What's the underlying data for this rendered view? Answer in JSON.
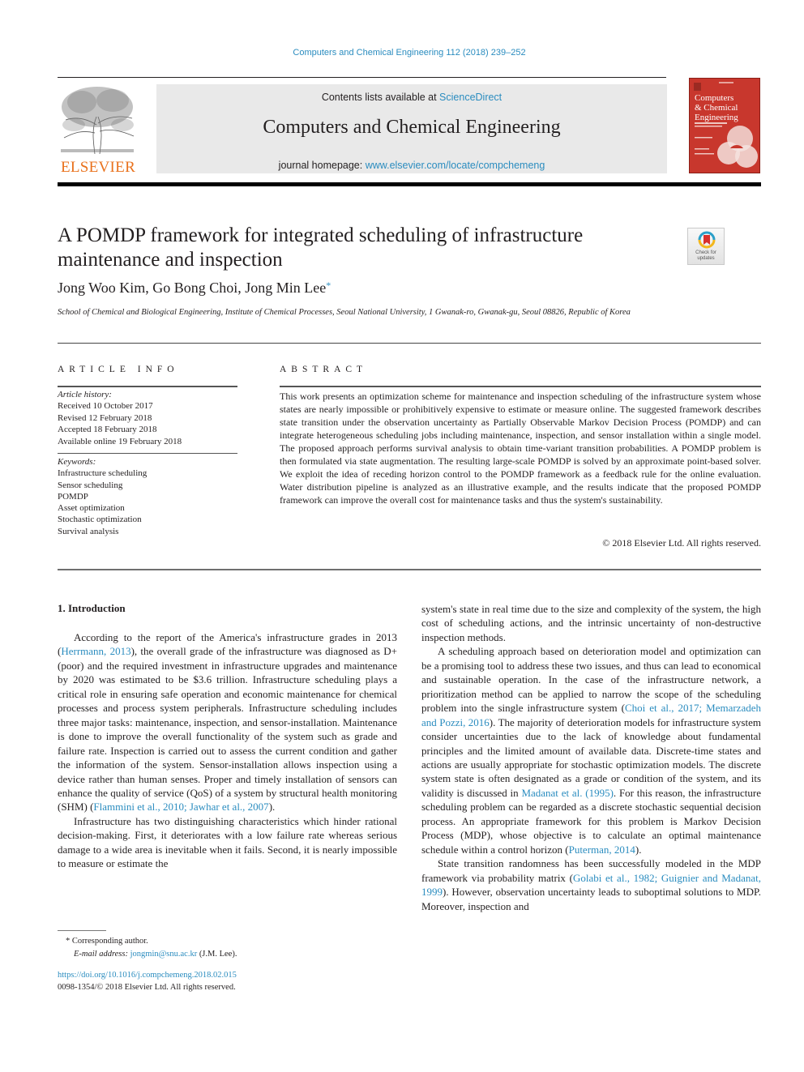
{
  "header": {
    "journal_ref": "Computers and Chemical Engineering 112 (2018) 239–252",
    "contents_prefix": "Contents lists available at ",
    "contents_link": "ScienceDirect",
    "journal_name": "Computers and Chemical Engineering",
    "homepage_prefix": "journal homepage: ",
    "homepage_link": "www.elsevier.com/locate/compchemeng",
    "publisher_wordmark": "ELSEVIER",
    "cover_title": [
      "Computers",
      "& Chemical",
      "Engineering"
    ],
    "check_updates_label": [
      "Check for",
      "updates"
    ]
  },
  "article": {
    "title": "A POMDP framework for integrated scheduling of infrastructure maintenance and inspection",
    "authors": "Jong Woo Kim, Go Bong Choi, Jong Min Lee",
    "corresponding_mark": "*",
    "affiliation": "School of Chemical and Biological Engineering, Institute of Chemical Processes, Seoul National University, 1 Gwanak-ro, Gwanak-gu, Seoul 08826, Republic of Korea"
  },
  "article_info": {
    "heading": "ARTICLE INFO",
    "history_label": "Article history:",
    "history": [
      "Received 10 October 2017",
      "Revised 12 February 2018",
      "Accepted 18 February 2018",
      "Available online 19 February 2018"
    ],
    "keywords_label": "Keywords:",
    "keywords": [
      "Infrastructure scheduling",
      "Sensor scheduling",
      "POMDP",
      "Asset optimization",
      "Stochastic optimization",
      "Survival analysis"
    ]
  },
  "abstract": {
    "heading": "ABSTRACT",
    "text": "This work presents an optimization scheme for maintenance and inspection scheduling of the infrastructure system whose states are nearly impossible or prohibitively expensive to estimate or measure online. The suggested framework describes state transition under the observation uncertainty as Partially Observable Markov Decision Process (POMDP) and can integrate heterogeneous scheduling jobs including maintenance, inspection, and sensor installation within a single model. The proposed approach performs survival analysis to obtain time-variant transition probabilities. A POMDP problem is then formulated via state augmentation. The resulting large-scale POMDP is solved by an approximate point-based solver. We exploit the idea of receding horizon control to the POMDP framework as a feedback rule for the online evaluation. Water distribution pipeline is analyzed as an illustrative example, and the results indicate that the proposed POMDP framework can improve the overall cost for maintenance tasks and thus the system's sustainability.",
    "copyright": "© 2018 Elsevier Ltd. All rights reserved."
  },
  "body": {
    "section_heading": "1.  Introduction",
    "left": {
      "p1": {
        "t1": "According to the report of the America's infrastructure grades in 2013 (",
        "c1": "Herrmann, 2013",
        "t2": "), the overall grade of the infrastructure was diagnosed as D+ (poor) and the required investment in infrastructure upgrades and maintenance by 2020 was estimated to be $3.6 trillion. Infrastructure scheduling plays a critical role in ensuring safe operation and economic maintenance for chemical processes and process system peripherals. Infrastructure scheduling includes three major tasks: maintenance, inspection, and sensor-installation. Maintenance is done to improve the overall functionality of the system such as grade and failure rate. Inspection is carried out to assess the current condition and gather the information of the system. Sensor-installation allows inspection using a device rather than human senses. Proper and timely installation of sensors can enhance the quality of service (QoS) of a system by structural health monitoring (SHM) (",
        "c2": "Flammini et al., 2010; Jawhar et al., 2007",
        "t3": ")."
      },
      "p2": "Infrastructure has two distinguishing characteristics which hinder rational decision-making. First, it deteriorates with a low failure rate whereas serious damage to a wide area is inevitable when it fails. Second, it is nearly impossible to measure or estimate the"
    },
    "right": {
      "p0": "system's state in real time due to the size and complexity of the system, the high cost of scheduling actions, and the intrinsic uncertainty of non-destructive inspection methods.",
      "p1": {
        "t1": "A scheduling approach based on deterioration model and optimization can be a promising tool to address these two issues, and thus can lead to economical and sustainable operation. In the case of the infrastructure network, a prioritization method can be applied to narrow the scope of the scheduling problem into the single infrastructure system (",
        "c1": "Choi et al., 2017; Memarzadeh and Pozzi, 2016",
        "t2": "). The majority of deterioration models for infrastructure system consider uncertainties due to the lack of knowledge about fundamental principles and the limited amount of available data. Discrete-time states and actions are usually appropriate for stochastic optimization models. The discrete system state is often designated as a grade or condition of the system, and its validity is discussed in ",
        "c2": "Madanat et al. (1995)",
        "t3": ". For this reason, the infrastructure scheduling problem can be regarded as a discrete stochastic sequential decision process. An appropriate framework for this problem is Markov Decision Process (MDP), whose objective is to calculate an optimal maintenance schedule within a control horizon (",
        "c3": "Puterman, 2014",
        "t4": ")."
      },
      "p2": {
        "t1": "State transition randomness has been successfully modeled in the MDP framework via probability matrix (",
        "c1": "Golabi et al., 1982; Guignier and Madanat, 1999",
        "t2": "). However, observation uncertainty leads to suboptimal solutions to MDP. Moreover, inspection and"
      }
    }
  },
  "footnotes": {
    "mark": "*",
    "corresponding": "Corresponding author.",
    "email_label": "E-mail address: ",
    "email": "jongmin@snu.ac.kr",
    "email_suffix": " (J.M. Lee).",
    "doi": "https://doi.org/10.1016/j.compchemeng.2018.02.015",
    "issn_line": "0098-1354/© 2018 Elsevier Ltd. All rights reserved."
  },
  "colors": {
    "link": "#2a8cbf",
    "elsevier_orange": "#e9711c",
    "cover_red": "#c8372d",
    "masthead_gray": "#e9e9e9"
  }
}
